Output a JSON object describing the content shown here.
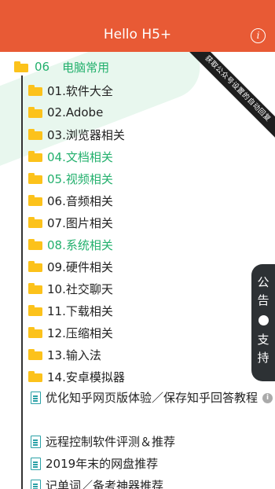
{
  "header": {
    "title": "Hello H5+",
    "info_icon": "info-icon"
  },
  "ribbon": {
    "text": "获取公众号设置的自动回复"
  },
  "tree": {
    "root": {
      "number": "06",
      "name": "电脑常用"
    },
    "folders": [
      {
        "label": "01.软件大全",
        "highlight": false
      },
      {
        "label": "02.Adobe",
        "highlight": false
      },
      {
        "label": "03.浏览器相关",
        "highlight": false
      },
      {
        "label": "04.文档相关",
        "highlight": true
      },
      {
        "label": "05.视频相关",
        "highlight": true
      },
      {
        "label": "06.音频相关",
        "highlight": false
      },
      {
        "label": "07.图片相关",
        "highlight": false
      },
      {
        "label": "08.系统相关",
        "highlight": true
      },
      {
        "label": "09.硬件相关",
        "highlight": false
      },
      {
        "label": "10.社交聊天",
        "highlight": false
      },
      {
        "label": "11.下载相关",
        "highlight": false
      },
      {
        "label": "12.压缩相关",
        "highlight": false
      },
      {
        "label": "13.输入法",
        "highlight": false
      },
      {
        "label": "14.安卓模拟器",
        "highlight": false
      }
    ],
    "files": [
      {
        "label": "优化知乎网页版体验／保存知乎回答教程",
        "has_info": true
      },
      {
        "label": "远程控制软件评测＆推荐",
        "has_info": false
      },
      {
        "label": "2019年末的网盘推荐",
        "has_info": false
      },
      {
        "label": "记单词／备考神器推荐",
        "has_info": false
      }
    ]
  },
  "side_tab": {
    "top": [
      "公",
      "告"
    ],
    "bottom": [
      "支",
      "持"
    ]
  },
  "colors": {
    "header": "#e85a35",
    "highlight": "#23b06d",
    "folder": "#fcc21b",
    "doc": "#2aa1a7",
    "side_tab": "#2d3134"
  }
}
